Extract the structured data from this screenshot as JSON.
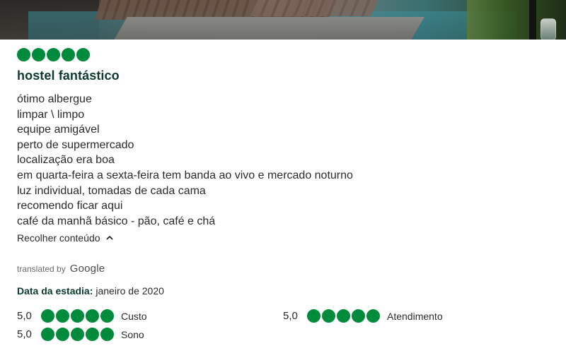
{
  "review": {
    "bubble_rating": 5,
    "bubble_color": "#008a3b",
    "title": "hostel fantástico",
    "body_lines": [
      "ótimo albergue",
      "limpar \\ limpo",
      "equipe amigável",
      "perto de supermercado",
      "localização era boa",
      "em quarta-feira a sexta-feira tem banda ao vivo e mercado noturno",
      "luz individual, tomadas de cada cama",
      "recomendo ficar aqui",
      "café da manhã básico - pão, café e chá"
    ],
    "collapse_label": "Recolher conteúdo",
    "collapse_icon": "chevron-up-icon",
    "translated_prefix": "translated by",
    "translated_provider": "Google",
    "stay_label": "Data da estadia:",
    "stay_value": "janeiro de 2020",
    "subratings": [
      {
        "score": "5,0",
        "bubbles": 5,
        "category": "Custo"
      },
      {
        "score": "5,0",
        "bubbles": 5,
        "category": "Atendimento"
      },
      {
        "score": "5,0",
        "bubbles": 5,
        "category": "Sono"
      }
    ]
  }
}
